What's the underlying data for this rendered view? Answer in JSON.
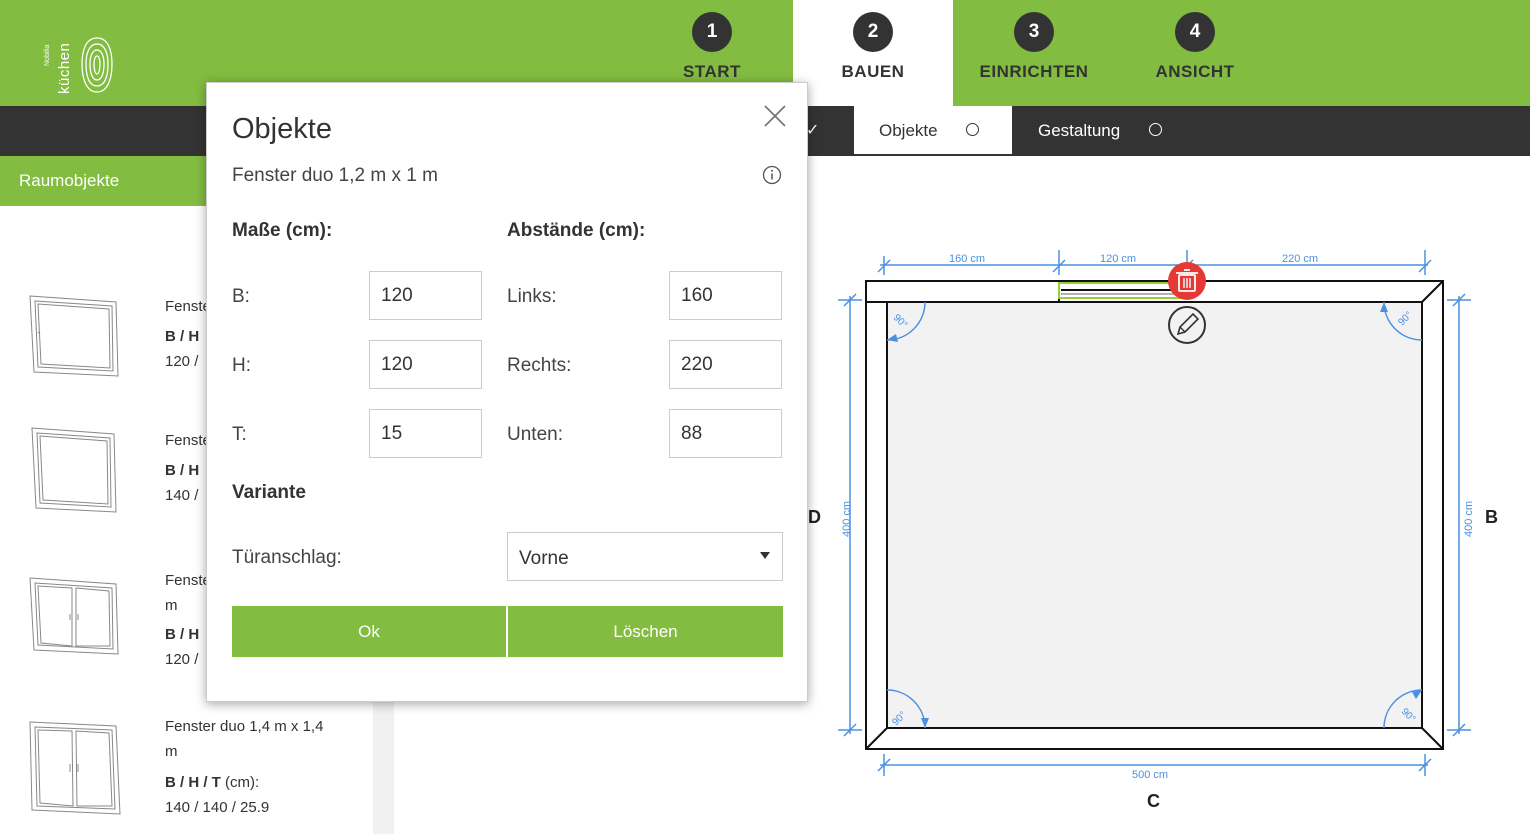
{
  "logo": {
    "text": "küchen",
    "small": "Nobilia"
  },
  "steps": [
    {
      "num": "1",
      "label": "START"
    },
    {
      "num": "2",
      "label": "BAUEN"
    },
    {
      "num": "3",
      "label": "EINRICHTEN"
    },
    {
      "num": "4",
      "label": "ANSICHT"
    }
  ],
  "subnav": {
    "check": "✓",
    "tabs": [
      {
        "label": "Objekte"
      },
      {
        "label": "Gestaltung"
      }
    ]
  },
  "left_panel": {
    "header": "Raumobjekte",
    "items": [
      {
        "title": "Fenster",
        "bh": "B / H",
        "val": "120 /"
      },
      {
        "title": "Fenster",
        "bh": "B / H",
        "val": "140 /"
      },
      {
        "title": "Fenster",
        "title2": "m",
        "bh": "B / H",
        "val": "120 /"
      },
      {
        "title": "Fenster duo 1,4 m x 1,4",
        "title2": "m",
        "bh_b": "B / H / T",
        "bh_rest": " (cm):",
        "val": "140 / 140 / 25.9"
      }
    ]
  },
  "modal": {
    "title": "Objekte",
    "subtitle": "Fenster duo 1,2 m x 1 m",
    "dims_heading": "Maße  (cm):",
    "dist_heading": "Abstände  (cm):",
    "fields": {
      "b_label": "B:",
      "b_value": "120",
      "h_label": "H:",
      "h_value": "120",
      "t_label": "T:",
      "t_value": "15",
      "links_label": "Links:",
      "links_value": "160",
      "rechts_label": "Rechts:",
      "rechts_value": "220",
      "unten_label": "Unten:",
      "unten_value": "88"
    },
    "variant_heading": "Variante",
    "door_label": "Türanschlag:",
    "door_value": "Vorne",
    "ok_label": "Ok",
    "delete_label": "Löschen"
  },
  "plan": {
    "top_dims": [
      "160 cm",
      "120 cm",
      "220 cm"
    ],
    "bottom_dim": "500 cm",
    "left_dim": "400 cm",
    "right_dim": "400 cm",
    "wall_labels": {
      "left": "D",
      "right": "B",
      "bottom": "C"
    },
    "angle": "90°"
  },
  "colors": {
    "brand_green": "#82bc41",
    "dark_bar": "#333333",
    "dimension_blue": "#4a90e2",
    "delete_red": "#e53935"
  }
}
